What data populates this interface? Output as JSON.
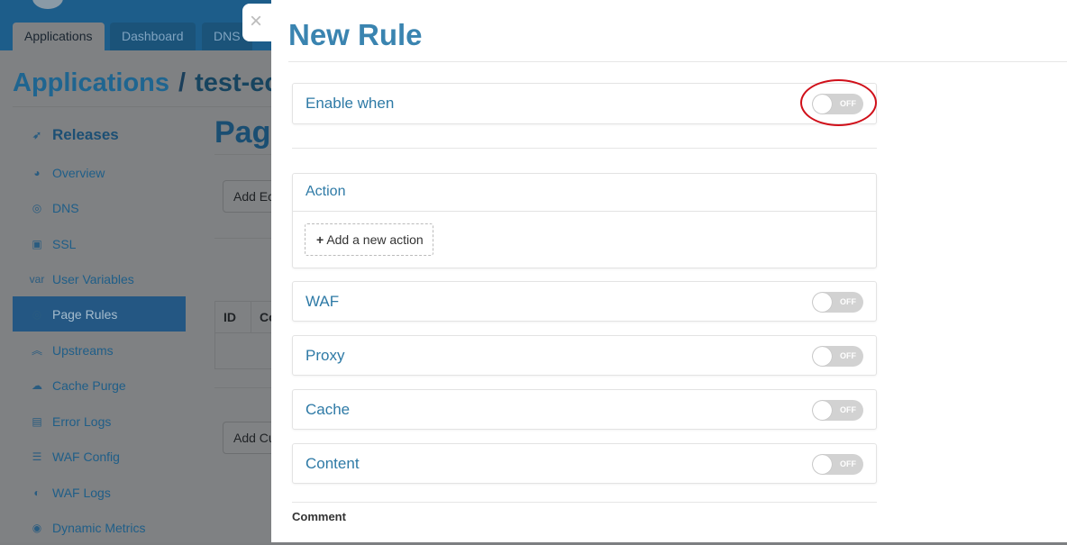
{
  "background": {
    "tabs": [
      "Applications",
      "Dashboard",
      "DNS"
    ],
    "breadcrumb": {
      "root": "Applications",
      "sep": "/",
      "current": "test-ec"
    },
    "page_title": "Pag",
    "buttons": [
      "Add Ec",
      "Add Cu"
    ],
    "table_headers": [
      "ID",
      "Co"
    ],
    "sidebar": [
      {
        "label": "Releases",
        "icon": "paper-plane-icon"
      },
      {
        "label": "Overview",
        "icon": "gauge-icon"
      },
      {
        "label": "DNS",
        "icon": "globe-icon"
      },
      {
        "label": "SSL",
        "icon": "certificate-icon"
      },
      {
        "label": "User Variables",
        "icon": "var-icon",
        "icon_text": "var"
      },
      {
        "label": "Page Rules",
        "icon": "target-icon",
        "active": true
      },
      {
        "label": "Upstreams",
        "icon": "chevrons-up-icon"
      },
      {
        "label": "Cache Purge",
        "icon": "cloud-icon"
      },
      {
        "label": "Error Logs",
        "icon": "log-file-icon"
      },
      {
        "label": "WAF Config",
        "icon": "list-icon"
      },
      {
        "label": "WAF Logs",
        "icon": "shield-log-icon"
      },
      {
        "label": "Dynamic Metrics",
        "icon": "pin-icon"
      }
    ]
  },
  "drawer": {
    "close": "×",
    "title": "New Rule",
    "enable_when": {
      "label": "Enable when",
      "toggle": "OFF"
    },
    "action": {
      "label": "Action",
      "add_button": "Add a new action",
      "plus": "+"
    },
    "sections": [
      {
        "label": "WAF",
        "toggle": "OFF"
      },
      {
        "label": "Proxy",
        "toggle": "OFF"
      },
      {
        "label": "Cache",
        "toggle": "OFF"
      },
      {
        "label": "Content",
        "toggle": "OFF"
      }
    ],
    "comment_label": "Comment"
  },
  "colors": {
    "accent": "#3a84b0",
    "highlight_ring": "#d0101a"
  }
}
